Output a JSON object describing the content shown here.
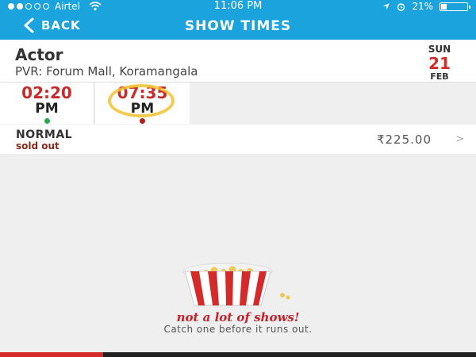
{
  "status_bar": {
    "carrier": "Airtel",
    "time": "11:06 PM",
    "battery": "21%",
    "battery_level": 0.21,
    "icons": [
      "signal-dots",
      "wifi-icon",
      "location-arrow-icon",
      "alarm-icon",
      "battery-icon"
    ]
  },
  "nav": {
    "back_label": "BACK",
    "title": "SHOW TIMES"
  },
  "movie": {
    "title": "Actor",
    "venue": "PVR: Forum Mall, Koramangala"
  },
  "date": {
    "day": "SUN",
    "num": "21",
    "month": "FEB"
  },
  "showtimes": [
    {
      "time": "02:20",
      "ampm": "PM",
      "availability_color": "#2aa84a"
    },
    {
      "time": "07:35",
      "ampm": "PM",
      "availability_color": "#b02020",
      "selected": true
    }
  ],
  "ticket": {
    "class": "NORMAL",
    "status": "sold out",
    "price": "₹225.00"
  },
  "empty_state": {
    "title": "not a lot of shows!",
    "subtitle": "Catch one before it runs out."
  },
  "colors": {
    "brand": "#1aa3dd",
    "accent": "#d52a2a"
  }
}
